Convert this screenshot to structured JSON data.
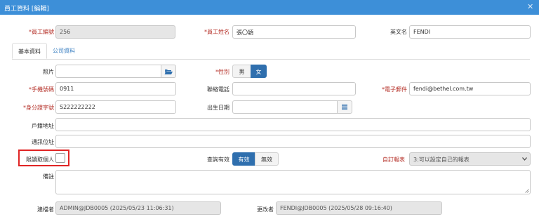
{
  "window": {
    "title": "員工資料 [編輯]",
    "close_glyph": "✕"
  },
  "tabs": [
    {
      "label": "基本資料"
    },
    {
      "label": "公司資料"
    }
  ],
  "fields": {
    "employee_no": {
      "label": "*員工編號",
      "value": "256"
    },
    "employee_name": {
      "label": "*員工姓名",
      "value": "張〇穎"
    },
    "english_name": {
      "label": "英文名",
      "value": "FENDI"
    },
    "photo": {
      "label": "照片",
      "value": "",
      "icon": "folder-open-icon"
    },
    "gender": {
      "label": "*性別",
      "options": [
        "男",
        "女"
      ],
      "selected": "女"
    },
    "mobile": {
      "label": "*手機號碼",
      "value": "0911"
    },
    "phone": {
      "label": "聯絡電話",
      "value": ""
    },
    "email": {
      "label": "*電子郵件",
      "value": "fendi@bethel.com.tw"
    },
    "id_number": {
      "label": "*身分證字號",
      "value": "S222222222"
    },
    "birthday": {
      "label": "出生日期",
      "value": "",
      "icon": "calendar-icon"
    },
    "registered_address": {
      "label": "戶籍地址",
      "value": ""
    },
    "mailing_address": {
      "label": "通訊位址",
      "value": ""
    },
    "read_self_only": {
      "label": "限讀取個人",
      "checked": false
    },
    "query_valid": {
      "label": "查詢有效",
      "options": [
        "有效",
        "無效"
      ],
      "selected": "有效"
    },
    "custom_report": {
      "label": "自訂報表",
      "value": "3:可以設定自己的報表"
    },
    "remarks": {
      "label": "備註",
      "value": ""
    },
    "created_by": {
      "label": "建檔者",
      "value": "ADMIN@JDB0005 (2025/05/23 11:06:31)"
    },
    "modified_by": {
      "label": "更改者",
      "value": "FENDI@JDB0005 (2025/05/28 09:16:40)"
    }
  },
  "colors": {
    "titlebar": "#3d8fd8",
    "required_label": "#b6322a",
    "active_toggle": "#2f6fae",
    "highlight_box": "#e02424"
  }
}
